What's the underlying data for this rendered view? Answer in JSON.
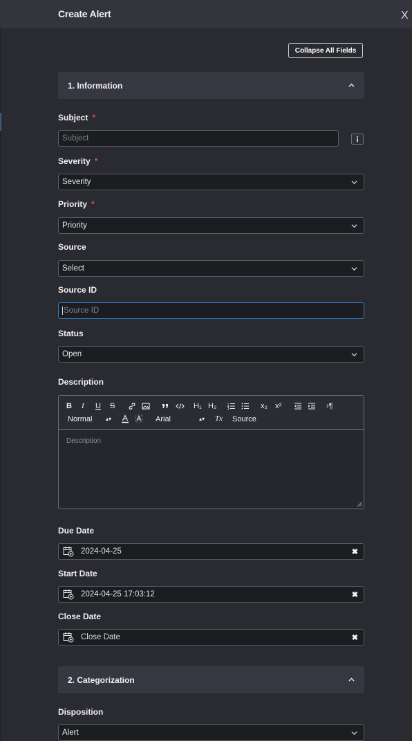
{
  "header": {
    "title": "Create Alert",
    "close_label": "X"
  },
  "collapse_all_label": "Collapse All Fields",
  "sections": [
    {
      "title": "1. Information"
    },
    {
      "title": "2. Categorization"
    }
  ],
  "fields": {
    "subject": {
      "label": "Subject",
      "required_mark": "*",
      "placeholder": "Subject"
    },
    "severity": {
      "label": "Severity",
      "required_mark": "*",
      "value": "Severity"
    },
    "priority": {
      "label": "Priority",
      "required_mark": "*",
      "value": "Priority"
    },
    "source": {
      "label": "Source",
      "value": "Select"
    },
    "source_id": {
      "label": "Source ID",
      "placeholder": "Source ID"
    },
    "status": {
      "label": "Status",
      "value": "Open"
    },
    "description": {
      "label": "Description",
      "placeholder": "Description",
      "toolbar": {
        "bold": "B",
        "italic": "I",
        "underline": "U",
        "strike": "S",
        "h1": "H₁",
        "h2": "H₂",
        "subscript": "x₂",
        "superscript": "x²",
        "paragraph": "›¶",
        "format": "Normal",
        "font": "Arial",
        "clear": "Tx",
        "source": "Source"
      }
    },
    "due_date": {
      "label": "Due Date",
      "value": "2024-04-25"
    },
    "start_date": {
      "label": "Start Date",
      "value": "2024-04-25 17:03:12"
    },
    "close_date": {
      "label": "Close Date",
      "placeholder": "Close Date"
    },
    "disposition": {
      "label": "Disposition",
      "value": "Alert"
    }
  },
  "icons": [
    "close-icon",
    "chevron-up-icon",
    "chevron-down-icon",
    "info-icon",
    "calendar-icon",
    "clear-icon",
    "resize-grip-icon"
  ]
}
